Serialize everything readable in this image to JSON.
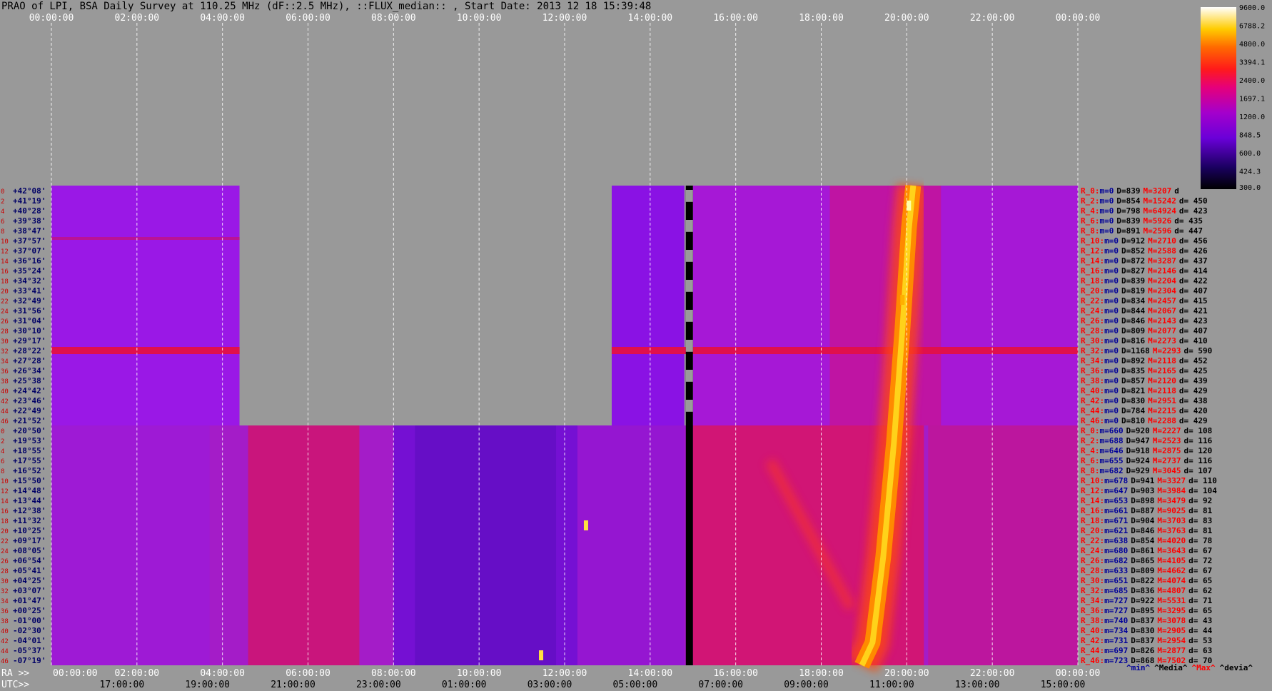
{
  "title": "PRAO of LPI, BSA Daily Survey at 110.25 MHz (dF::2.5 MHz), ::FLUX_median:: , Start Date: 2013 12 18 15:39:48",
  "colors": {
    "background": "#999999",
    "dec_label": "#000066",
    "beam_index": "#cc0000",
    "stat_min": "#000099",
    "stat_max": "#ff0000",
    "stat_text": "#000000",
    "grid": "#ffffff"
  },
  "chart_data": {
    "type": "heatmap",
    "top_time_ticks": [
      "00:00:00",
      "02:00:00",
      "04:00:00",
      "06:00:00",
      "08:00:00",
      "10:00:00",
      "12:00:00",
      "14:00:00",
      "16:00:00",
      "18:00:00",
      "20:00:00",
      "22:00:00",
      "00:00:00"
    ],
    "bottom_ra_prefix": "RA >>",
    "bottom_ra_ticks": [
      "00:00:00",
      "02:00:00",
      "04:00:00",
      "06:00:00",
      "08:00:00",
      "10:00:00",
      "12:00:00",
      "14:00:00",
      "16:00:00",
      "18:00:00",
      "20:00:00",
      "22:00:00",
      "00:00:00"
    ],
    "bottom_utc_prefix": "UTC>>",
    "bottom_utc_ticks": [
      "17:00:00",
      "19:00:00",
      "21:00:00",
      "23:00:00",
      "01:00:00",
      "03:00:00",
      "05:00:00",
      "07:00:00",
      "09:00:00",
      "11:00:00",
      "13:00:00",
      "15:00:00"
    ],
    "time_range_h": [
      0,
      24
    ],
    "declinations": [
      "+42°08'",
      "+41°19'",
      "+40°28'",
      "+39°38'",
      "+38°47'",
      "+37°57'",
      "+37°07'",
      "+36°16'",
      "+35°24'",
      "+34°32'",
      "+33°41'",
      "+32°49'",
      "+31°56'",
      "+31°04'",
      "+30°10'",
      "+29°17'",
      "+28°22'",
      "+27°28'",
      "+26°34'",
      "+25°38'",
      "+24°42'",
      "+23°46'",
      "+22°49'",
      "+21°52'",
      "+20°50'",
      "+19°53'",
      "+18°55'",
      "+17°55'",
      "+16°52'",
      "+15°50'",
      "+14°48'",
      "+13°44'",
      "+12°38'",
      "+11°32'",
      "+10°25'",
      "+09°17'",
      "+08°05'",
      "+06°54'",
      "+05°41'",
      "+04°25'",
      "+03°07'",
      "+01°47'",
      "+00°25'",
      "-01°00'",
      "-02°30'",
      "-04°01'",
      "-05°37'",
      "-07°19'"
    ],
    "beam_indices": [
      "0",
      "2",
      "4",
      "6",
      "8",
      "10",
      "12",
      "14",
      "16",
      "18",
      "20",
      "22",
      "24",
      "26",
      "28",
      "30",
      "32",
      "34",
      "36",
      "38",
      "40",
      "42",
      "44",
      "46",
      "0",
      "2",
      "4",
      "6",
      "8",
      "10",
      "12",
      "14",
      "16",
      "18",
      "20",
      "22",
      "24",
      "26",
      "28",
      "30",
      "32",
      "34",
      "36",
      "38",
      "40",
      "42",
      "44",
      "46"
    ],
    "colorbar": {
      "ticks": [
        "9600.0",
        "6788.2",
        "4800.0",
        "3394.1",
        "2400.0",
        "1697.1",
        "1200.0",
        "848.5",
        "600.0",
        "424.3",
        "300.0"
      ],
      "range": [
        300,
        9600
      ],
      "scale": "log"
    },
    "stats_header": [
      "^min^",
      "^Media^",
      "^Max^",
      "^devia^"
    ],
    "stats": [
      {
        "beam": "R_0:",
        "min": "m=0",
        "median": "D=839",
        "max": "M=3207",
        "dev": "d"
      },
      {
        "beam": "R_2:",
        "min": "m=0",
        "median": "D=854",
        "max": "M=15242",
        "dev": "d= 450"
      },
      {
        "beam": "R_4:",
        "min": "m=0",
        "median": "D=798",
        "max": "M=64924",
        "dev": "d= 423"
      },
      {
        "beam": "R_6:",
        "min": "m=0",
        "median": "D=839",
        "max": "M=5926",
        "dev": "d= 435"
      },
      {
        "beam": "R_8:",
        "min": "m=0",
        "median": "D=891",
        "max": "M=2596",
        "dev": "d= 447"
      },
      {
        "beam": "R_10:",
        "min": "m=0",
        "median": "D=912",
        "max": "M=2710",
        "dev": "d= 456"
      },
      {
        "beam": "R_12:",
        "min": "m=0",
        "median": "D=852",
        "max": "M=2588",
        "dev": "d= 426"
      },
      {
        "beam": "R_14:",
        "min": "m=0",
        "median": "D=872",
        "max": "M=3287",
        "dev": "d= 437"
      },
      {
        "beam": "R_16:",
        "min": "m=0",
        "median": "D=827",
        "max": "M=2146",
        "dev": "d= 414"
      },
      {
        "beam": "R_18:",
        "min": "m=0",
        "median": "D=839",
        "max": "M=2204",
        "dev": "d= 422"
      },
      {
        "beam": "R_20:",
        "min": "m=0",
        "median": "D=819",
        "max": "M=2304",
        "dev": "d= 407"
      },
      {
        "beam": "R_22:",
        "min": "m=0",
        "median": "D=834",
        "max": "M=2457",
        "dev": "d= 415"
      },
      {
        "beam": "R_24:",
        "min": "m=0",
        "median": "D=844",
        "max": "M=2067",
        "dev": "d= 421"
      },
      {
        "beam": "R_26:",
        "min": "m=0",
        "median": "D=846",
        "max": "M=2143",
        "dev": "d= 423"
      },
      {
        "beam": "R_28:",
        "min": "m=0",
        "median": "D=809",
        "max": "M=2077",
        "dev": "d= 407"
      },
      {
        "beam": "R_30:",
        "min": "m=0",
        "median": "D=816",
        "max": "M=2273",
        "dev": "d= 410"
      },
      {
        "beam": "R_32:",
        "min": "m=0",
        "median": "D=1168",
        "max": "M=2293",
        "dev": "d= 590"
      },
      {
        "beam": "R_34:",
        "min": "m=0",
        "median": "D=892",
        "max": "M=2118",
        "dev": "d= 452"
      },
      {
        "beam": "R_36:",
        "min": "m=0",
        "median": "D=835",
        "max": "M=2165",
        "dev": "d= 425"
      },
      {
        "beam": "R_38:",
        "min": "m=0",
        "median": "D=857",
        "max": "M=2120",
        "dev": "d= 439"
      },
      {
        "beam": "R_40:",
        "min": "m=0",
        "median": "D=821",
        "max": "M=2118",
        "dev": "d= 429"
      },
      {
        "beam": "R_42:",
        "min": "m=0",
        "median": "D=830",
        "max": "M=2951",
        "dev": "d= 438"
      },
      {
        "beam": "R_44:",
        "min": "m=0",
        "median": "D=784",
        "max": "M=2215",
        "dev": "d= 420"
      },
      {
        "beam": "R_46:",
        "min": "m=0",
        "median": "D=810",
        "max": "M=2288",
        "dev": "d= 429"
      },
      {
        "beam": "R_0:",
        "min": "m=660",
        "median": "D=920",
        "max": "M=2227",
        "dev": "d= 108"
      },
      {
        "beam": "R_2:",
        "min": "m=688",
        "median": "D=947",
        "max": "M=2523",
        "dev": "d= 116"
      },
      {
        "beam": "R_4:",
        "min": "m=646",
        "median": "D=918",
        "max": "M=2875",
        "dev": "d= 120"
      },
      {
        "beam": "R_6:",
        "min": "m=655",
        "median": "D=924",
        "max": "M=2737",
        "dev": "d= 116"
      },
      {
        "beam": "R_8:",
        "min": "m=682",
        "median": "D=929",
        "max": "M=3045",
        "dev": "d= 107"
      },
      {
        "beam": "R_10:",
        "min": "m=678",
        "median": "D=941",
        "max": "M=3327",
        "dev": "d= 110"
      },
      {
        "beam": "R_12:",
        "min": "m=647",
        "median": "D=903",
        "max": "M=3984",
        "dev": "d= 104"
      },
      {
        "beam": "R_14:",
        "min": "m=653",
        "median": "D=898",
        "max": "M=3479",
        "dev": "d= 92"
      },
      {
        "beam": "R_16:",
        "min": "m=661",
        "median": "D=887",
        "max": "M=9025",
        "dev": "d= 81"
      },
      {
        "beam": "R_18:",
        "min": "m=671",
        "median": "D=904",
        "max": "M=3703",
        "dev": "d= 83"
      },
      {
        "beam": "R_20:",
        "min": "m=621",
        "median": "D=846",
        "max": "M=3763",
        "dev": "d= 81"
      },
      {
        "beam": "R_22:",
        "min": "m=638",
        "median": "D=854",
        "max": "M=4020",
        "dev": "d= 78"
      },
      {
        "beam": "R_24:",
        "min": "m=680",
        "median": "D=861",
        "max": "M=3643",
        "dev": "d= 67"
      },
      {
        "beam": "R_26:",
        "min": "m=682",
        "median": "D=865",
        "max": "M=4105",
        "dev": "d= 72"
      },
      {
        "beam": "R_28:",
        "min": "m=633",
        "median": "D=809",
        "max": "M=4662",
        "dev": "d= 67"
      },
      {
        "beam": "R_30:",
        "min": "m=651",
        "median": "D=822",
        "max": "M=4074",
        "dev": "d= 65"
      },
      {
        "beam": "R_32:",
        "min": "m=685",
        "median": "D=836",
        "max": "M=4807",
        "dev": "d= 62"
      },
      {
        "beam": "R_34:",
        "min": "m=727",
        "median": "D=922",
        "max": "M=5531",
        "dev": "d= 71"
      },
      {
        "beam": "R_36:",
        "min": "m=727",
        "median": "D=895",
        "max": "M=3295",
        "dev": "d= 65"
      },
      {
        "beam": "R_38:",
        "min": "m=740",
        "median": "D=837",
        "max": "M=3078",
        "dev": "d= 43"
      },
      {
        "beam": "R_40:",
        "min": "m=734",
        "median": "D=830",
        "max": "M=2905",
        "dev": "d= 44"
      },
      {
        "beam": "R_42:",
        "min": "m=731",
        "median": "D=837",
        "max": "M=2954",
        "dev": "d= 53"
      },
      {
        "beam": "R_44:",
        "min": "m=697",
        "median": "D=826",
        "max": "M=2877",
        "dev": "d= 63"
      },
      {
        "beam": "R_46:",
        "min": "m=723",
        "median": "D=868",
        "max": "M=7502",
        "dev": "d= 70"
      }
    ]
  }
}
